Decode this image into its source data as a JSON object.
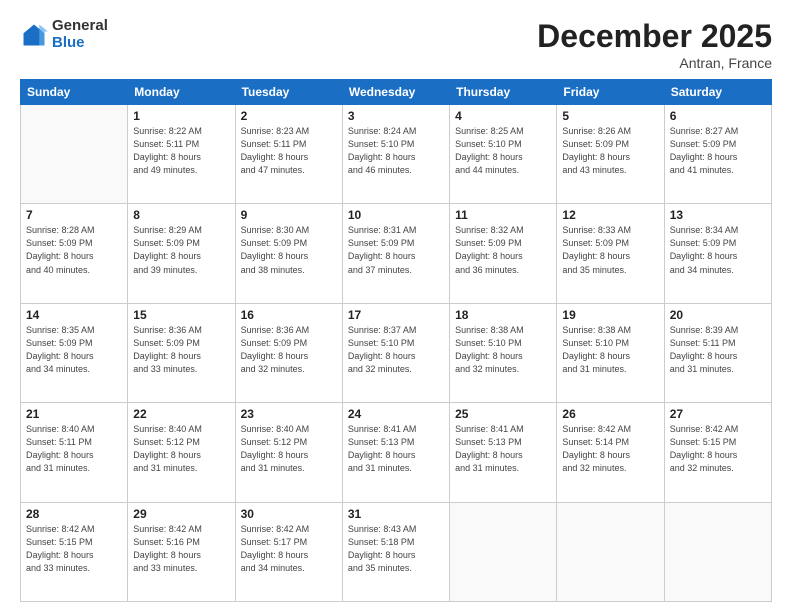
{
  "header": {
    "logo_general": "General",
    "logo_blue": "Blue",
    "month_title": "December 2025",
    "location": "Antran, France"
  },
  "days_of_week": [
    "Sunday",
    "Monday",
    "Tuesday",
    "Wednesday",
    "Thursday",
    "Friday",
    "Saturday"
  ],
  "weeks": [
    [
      {
        "day": "",
        "info": ""
      },
      {
        "day": "1",
        "info": "Sunrise: 8:22 AM\nSunset: 5:11 PM\nDaylight: 8 hours\nand 49 minutes."
      },
      {
        "day": "2",
        "info": "Sunrise: 8:23 AM\nSunset: 5:11 PM\nDaylight: 8 hours\nand 47 minutes."
      },
      {
        "day": "3",
        "info": "Sunrise: 8:24 AM\nSunset: 5:10 PM\nDaylight: 8 hours\nand 46 minutes."
      },
      {
        "day": "4",
        "info": "Sunrise: 8:25 AM\nSunset: 5:10 PM\nDaylight: 8 hours\nand 44 minutes."
      },
      {
        "day": "5",
        "info": "Sunrise: 8:26 AM\nSunset: 5:09 PM\nDaylight: 8 hours\nand 43 minutes."
      },
      {
        "day": "6",
        "info": "Sunrise: 8:27 AM\nSunset: 5:09 PM\nDaylight: 8 hours\nand 41 minutes."
      }
    ],
    [
      {
        "day": "7",
        "info": "Sunrise: 8:28 AM\nSunset: 5:09 PM\nDaylight: 8 hours\nand 40 minutes."
      },
      {
        "day": "8",
        "info": "Sunrise: 8:29 AM\nSunset: 5:09 PM\nDaylight: 8 hours\nand 39 minutes."
      },
      {
        "day": "9",
        "info": "Sunrise: 8:30 AM\nSunset: 5:09 PM\nDaylight: 8 hours\nand 38 minutes."
      },
      {
        "day": "10",
        "info": "Sunrise: 8:31 AM\nSunset: 5:09 PM\nDaylight: 8 hours\nand 37 minutes."
      },
      {
        "day": "11",
        "info": "Sunrise: 8:32 AM\nSunset: 5:09 PM\nDaylight: 8 hours\nand 36 minutes."
      },
      {
        "day": "12",
        "info": "Sunrise: 8:33 AM\nSunset: 5:09 PM\nDaylight: 8 hours\nand 35 minutes."
      },
      {
        "day": "13",
        "info": "Sunrise: 8:34 AM\nSunset: 5:09 PM\nDaylight: 8 hours\nand 34 minutes."
      }
    ],
    [
      {
        "day": "14",
        "info": "Sunrise: 8:35 AM\nSunset: 5:09 PM\nDaylight: 8 hours\nand 34 minutes."
      },
      {
        "day": "15",
        "info": "Sunrise: 8:36 AM\nSunset: 5:09 PM\nDaylight: 8 hours\nand 33 minutes."
      },
      {
        "day": "16",
        "info": "Sunrise: 8:36 AM\nSunset: 5:09 PM\nDaylight: 8 hours\nand 32 minutes."
      },
      {
        "day": "17",
        "info": "Sunrise: 8:37 AM\nSunset: 5:10 PM\nDaylight: 8 hours\nand 32 minutes."
      },
      {
        "day": "18",
        "info": "Sunrise: 8:38 AM\nSunset: 5:10 PM\nDaylight: 8 hours\nand 32 minutes."
      },
      {
        "day": "19",
        "info": "Sunrise: 8:38 AM\nSunset: 5:10 PM\nDaylight: 8 hours\nand 31 minutes."
      },
      {
        "day": "20",
        "info": "Sunrise: 8:39 AM\nSunset: 5:11 PM\nDaylight: 8 hours\nand 31 minutes."
      }
    ],
    [
      {
        "day": "21",
        "info": "Sunrise: 8:40 AM\nSunset: 5:11 PM\nDaylight: 8 hours\nand 31 minutes."
      },
      {
        "day": "22",
        "info": "Sunrise: 8:40 AM\nSunset: 5:12 PM\nDaylight: 8 hours\nand 31 minutes."
      },
      {
        "day": "23",
        "info": "Sunrise: 8:40 AM\nSunset: 5:12 PM\nDaylight: 8 hours\nand 31 minutes."
      },
      {
        "day": "24",
        "info": "Sunrise: 8:41 AM\nSunset: 5:13 PM\nDaylight: 8 hours\nand 31 minutes."
      },
      {
        "day": "25",
        "info": "Sunrise: 8:41 AM\nSunset: 5:13 PM\nDaylight: 8 hours\nand 31 minutes."
      },
      {
        "day": "26",
        "info": "Sunrise: 8:42 AM\nSunset: 5:14 PM\nDaylight: 8 hours\nand 32 minutes."
      },
      {
        "day": "27",
        "info": "Sunrise: 8:42 AM\nSunset: 5:15 PM\nDaylight: 8 hours\nand 32 minutes."
      }
    ],
    [
      {
        "day": "28",
        "info": "Sunrise: 8:42 AM\nSunset: 5:15 PM\nDaylight: 8 hours\nand 33 minutes."
      },
      {
        "day": "29",
        "info": "Sunrise: 8:42 AM\nSunset: 5:16 PM\nDaylight: 8 hours\nand 33 minutes."
      },
      {
        "day": "30",
        "info": "Sunrise: 8:42 AM\nSunset: 5:17 PM\nDaylight: 8 hours\nand 34 minutes."
      },
      {
        "day": "31",
        "info": "Sunrise: 8:43 AM\nSunset: 5:18 PM\nDaylight: 8 hours\nand 35 minutes."
      },
      {
        "day": "",
        "info": ""
      },
      {
        "day": "",
        "info": ""
      },
      {
        "day": "",
        "info": ""
      }
    ]
  ]
}
